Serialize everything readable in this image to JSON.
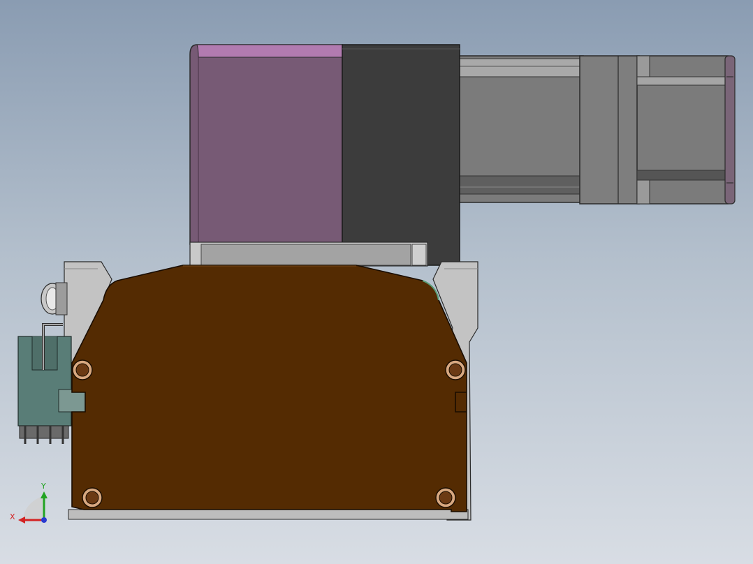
{
  "viewport": {
    "background_top": "#8a9cb2",
    "background_bottom": "#d8dde4"
  },
  "model": {
    "parts": {
      "motor_housing_color": "#775a75",
      "motor_housing_top_highlight": "#b27bb0",
      "motor_endcap_color": "#3c3c3c",
      "gearbox_color": "#7b7b7b",
      "base_plate_color": "#542b02",
      "frame_color": "#c3c3c3",
      "connector_color": "#597d77",
      "hole_rim_color": "#d8a880"
    }
  },
  "triad": {
    "x_label": "X",
    "y_label": "Y",
    "x_color": "#d32222",
    "y_color": "#22a322",
    "z_color": "#2a3ad0"
  }
}
